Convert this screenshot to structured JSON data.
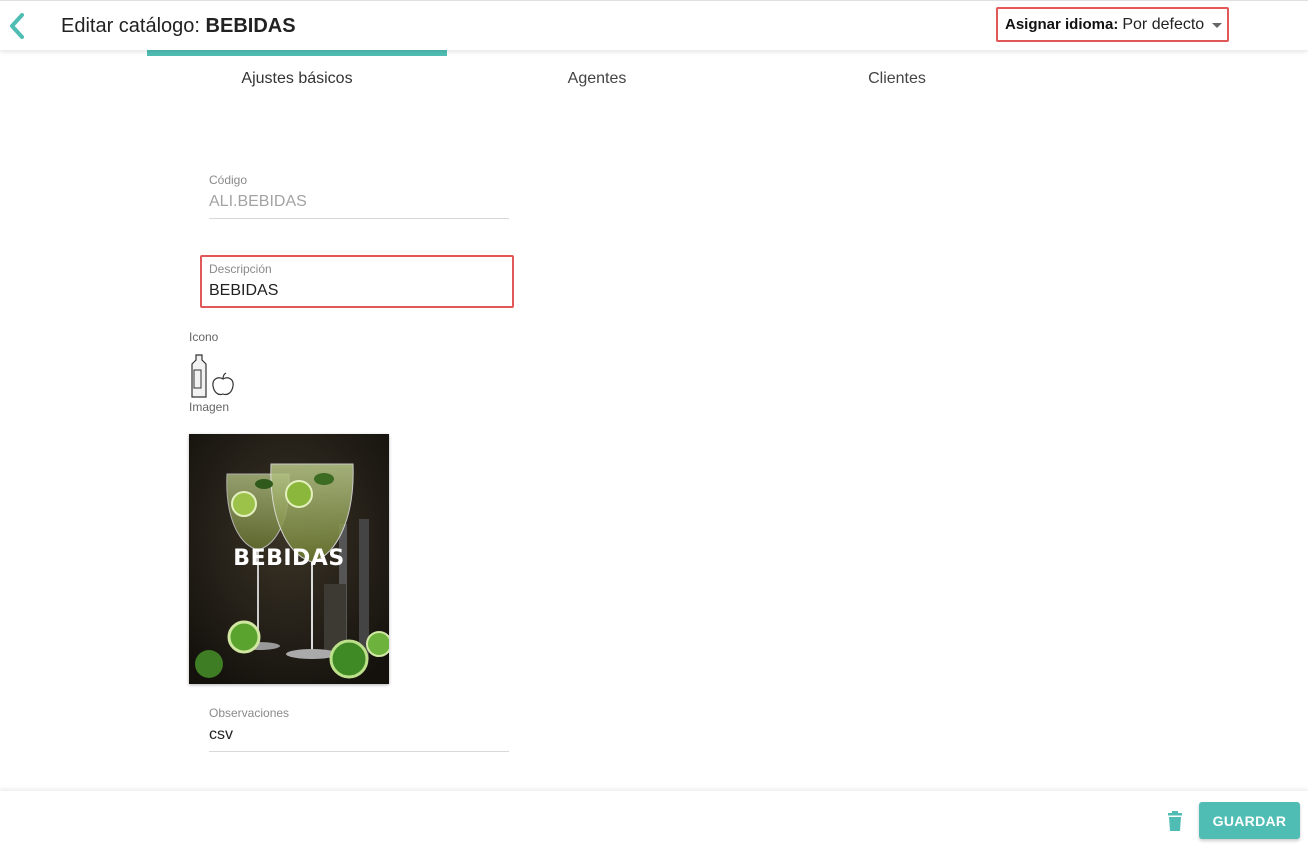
{
  "header": {
    "title_prefix": "Editar catálogo:",
    "title_name": "BEBIDAS",
    "language_label": "Asignar idioma:",
    "language_value": "Por defecto"
  },
  "tabs": [
    {
      "label": "Ajustes básicos",
      "active": true
    },
    {
      "label": "Agentes",
      "active": false
    },
    {
      "label": "Clientes",
      "active": false
    }
  ],
  "form": {
    "codigo_label": "Código",
    "codigo_value": "ALI.BEBIDAS",
    "descripcion_label": "Descripción",
    "descripcion_value": "BEBIDAS",
    "icono_label": "Icono",
    "icono_name": "bottle-and-apple-icon",
    "imagen_label": "Imagen",
    "imagen_text": "BEBIDAS",
    "observaciones_label": "Observaciones",
    "observaciones_value": "csv"
  },
  "footer": {
    "save_label": "GUARDAR"
  },
  "colors": {
    "accent": "#4fbdb3",
    "highlight_border": "#e25757"
  }
}
